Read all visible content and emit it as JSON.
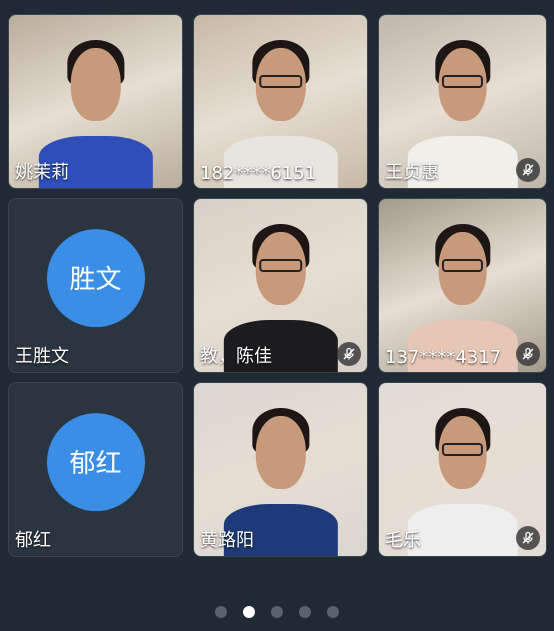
{
  "tiles": [
    {
      "name": "姚茉莉",
      "type": "video",
      "muted": false,
      "glasses": false,
      "shirt": "#2e4fb8",
      "bg": "#b9ad9c"
    },
    {
      "name": "182****6151",
      "type": "video",
      "muted": false,
      "glasses": true,
      "shirt": "#e8e4df",
      "bg": "#c7b9a6"
    },
    {
      "name": "王贞惠",
      "type": "video",
      "muted": true,
      "glasses": true,
      "shirt": "#f1efe9",
      "bg": "#bfb6aa"
    },
    {
      "name": "王胜文",
      "type": "avatar",
      "avatar_text": "胜文",
      "muted": false
    },
    {
      "name": "教，陈佳",
      "type": "video",
      "muted": true,
      "glasses": true,
      "shirt": "#1c1b1e",
      "bg": "#d8cfc6"
    },
    {
      "name": "137****4317",
      "type": "video",
      "muted": true,
      "glasses": true,
      "shirt": "#e8c6b6",
      "bg": "#a49a8b"
    },
    {
      "name": "郁红",
      "type": "avatar",
      "avatar_text": "郁红",
      "muted": false
    },
    {
      "name": "黄路阳",
      "type": "video",
      "muted": false,
      "glasses": false,
      "shirt": "#1f3a78",
      "bg": "#d9d6d0"
    },
    {
      "name": "毛乐",
      "type": "video",
      "muted": true,
      "glasses": true,
      "shirt": "#eeeeee",
      "bg": "#e0dcd6"
    }
  ],
  "pagination": {
    "count": 5,
    "active_index": 1
  },
  "colors": {
    "background": "#1f2a35",
    "avatar": "#3a8ee6",
    "dot_active": "#ffffff",
    "dot_inactive": "#59636e"
  }
}
